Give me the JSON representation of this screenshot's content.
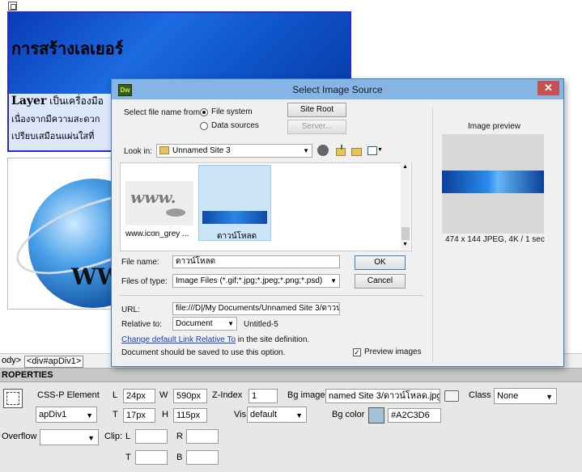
{
  "design": {
    "title_thai": "การสร้างเลเยอร์",
    "line1_bold": "Layer",
    "line1_rest": " เป็นเครื่องมือ",
    "line2": "เนื่องจากมีความสะดวก",
    "line3": "เปรียบเสมือนแผ่นใสที่",
    "globe_text": "WW"
  },
  "tagbar": {
    "body": "ody>",
    "div": "<div#apDiv1>"
  },
  "properties": {
    "header": "ROPERTIES",
    "element_type": "CSS-P Element",
    "element_id": "apDiv1",
    "L_label": "L",
    "L": "24px",
    "W_label": "W",
    "W": "590px",
    "zindex_label": "Z-Index",
    "zindex": "1",
    "bgimage_label": "Bg image",
    "bgimage": "named Site 3/ดาวน์โหลด.jpg",
    "class_label": "Class",
    "class": "None",
    "T_label": "T",
    "T": "17px",
    "H_label": "H",
    "H": "115px",
    "vis_label": "Vis",
    "vis": "default",
    "bgcolor_label": "Bg color",
    "bgcolor": "#A2C3D6",
    "overflow_label": "Overflow",
    "overflow": "",
    "clip_label": "Clip:",
    "clip_L_label": "L",
    "clip_R_label": "R",
    "clip_T_label": "T",
    "clip_B_label": "B",
    "clip_L": "",
    "clip_R": "",
    "clip_T": "",
    "clip_B": ""
  },
  "dialog": {
    "app_icon": "Dw",
    "title": "Select Image Source",
    "close": "✕",
    "select_from_label": "Select file name from:",
    "radio_file_system": "File system",
    "radio_data_sources": "Data sources",
    "site_root_btn": "Site Root",
    "server_btn": "Server...",
    "look_in_label": "Look in:",
    "look_in_value": "Unnamed Site 3",
    "files": [
      {
        "name": "www.icon_grey ...",
        "selected": false
      },
      {
        "name": "ดาวน์โหลด",
        "selected": true
      }
    ],
    "preview_label": "Image preview",
    "preview_info": "474 x 144 JPEG, 4K / 1 sec",
    "file_name_label": "File name:",
    "file_name_value": "ดาวน์โหลด",
    "ok_btn": "OK",
    "files_of_type_label": "Files of type:",
    "files_of_type_value": "Image Files (*.gif;*.jpg;*.jpeg;*.png;*.psd)",
    "cancel_btn": "Cancel",
    "url_label": "URL:",
    "url_value": "file:///D|/My Documents/Unnamed Site 3/ดาวน์",
    "relative_label": "Relative to:",
    "relative_value": "Document",
    "relative_doc": "Untitled-5",
    "change_link": "Change default Link Relative To",
    "change_link_suffix": " in the site definition.",
    "note": "Document should be saved to use this option.",
    "preview_images_label": "Preview images",
    "preview_images_checked": "✓"
  }
}
